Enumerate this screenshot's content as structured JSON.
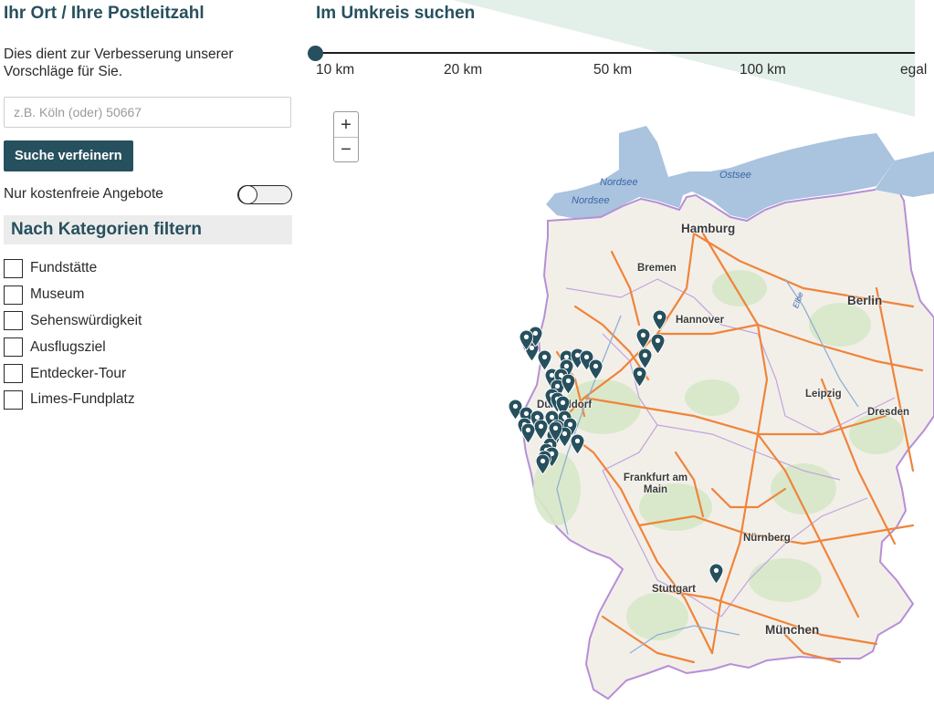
{
  "location": {
    "title": "Ihr Ort / Ihre Postleitzahl",
    "description": "Dies dient zur Verbesserung unserer Vorschläge für Sie.",
    "placeholder": "z.B. Köln (oder) 50667",
    "value": "",
    "refine_label": "Suche verfeinern",
    "free_label": "Nur kostenfreie Angebote",
    "free_enabled": false
  },
  "categories": {
    "title": "Nach Kategorien filtern",
    "items": [
      {
        "label": "Fundstätte",
        "checked": false
      },
      {
        "label": "Museum",
        "checked": false
      },
      {
        "label": "Sehenswürdigkeit",
        "checked": false
      },
      {
        "label": "Ausflugsziel",
        "checked": false
      },
      {
        "label": "Entdecker-Tour",
        "checked": false
      },
      {
        "label": "Limes-Fundplatz",
        "checked": false
      }
    ]
  },
  "radius": {
    "title": "Im Umkreis suchen",
    "ticks": [
      "10 km",
      "20 km",
      "50 km",
      "100 km",
      "egal"
    ],
    "selected": "10 km"
  },
  "map": {
    "zoom_in": "+",
    "zoom_out": "−",
    "cities": {
      "hamburg": "Hamburg",
      "bremen": "Bremen",
      "berlin": "Berlin",
      "hannover": "Hannover",
      "leipzig": "Leipzig",
      "dresden": "Dresden",
      "duesseldorf": "Düsseldorf",
      "frankfurt": "Frankfurt am Main",
      "nuernberg": "Nürnberg",
      "stuttgart": "Stuttgart",
      "muenchen": "München"
    },
    "seas": {
      "nordsee_1": "Nordsee",
      "nordsee_2": "Nordsee",
      "ostsee": "Ostsee"
    },
    "rivers": {
      "elbe": "Elbe"
    },
    "marker_icon": "map-pin-icon",
    "marker_count": 42
  },
  "colors": {
    "accent": "#27505e",
    "wedge": "#e3efe9",
    "sea": "#aac3de",
    "land": "#f2efe9",
    "roads": "#f0843a",
    "border": "#b78fd6",
    "marker": "#27505e"
  }
}
